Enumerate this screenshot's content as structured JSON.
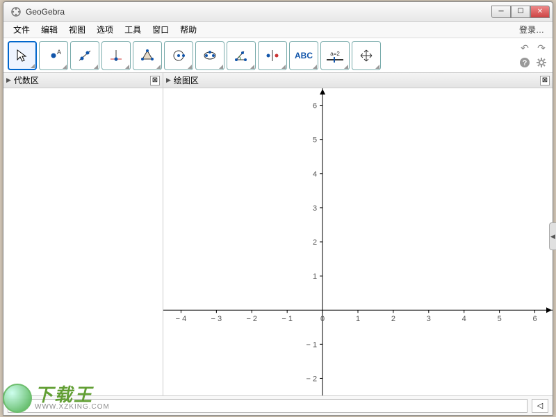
{
  "window": {
    "title": "GeoGebra"
  },
  "menu": {
    "items": [
      "文件",
      "编辑",
      "视图",
      "选项",
      "工具",
      "窗口",
      "帮助"
    ],
    "login": "登录…"
  },
  "toolbar": {
    "tools": [
      {
        "name": "move-tool",
        "selected": true
      },
      {
        "name": "point-tool",
        "selected": false
      },
      {
        "name": "line-tool",
        "selected": false
      },
      {
        "name": "perpendicular-tool",
        "selected": false
      },
      {
        "name": "polygon-tool",
        "selected": false
      },
      {
        "name": "circle-tool",
        "selected": false
      },
      {
        "name": "ellipse-tool",
        "selected": false
      },
      {
        "name": "angle-tool",
        "selected": false
      },
      {
        "name": "reflect-tool",
        "selected": false
      },
      {
        "name": "text-tool",
        "selected": false
      },
      {
        "name": "slider-tool",
        "selected": false
      },
      {
        "name": "move-graphics-tool",
        "selected": false
      }
    ],
    "text_label": "ABC",
    "slider_label": "a=2"
  },
  "panels": {
    "algebra": {
      "title": "代数区"
    },
    "graphics": {
      "title": "绘图区"
    }
  },
  "chart_data": {
    "type": "scatter",
    "title": "",
    "xlabel": "",
    "ylabel": "",
    "xlim": [
      -4.5,
      6.5
    ],
    "ylim": [
      -2.5,
      6.5
    ],
    "xticks": [
      -4,
      -3,
      -2,
      -1,
      0,
      1,
      2,
      3,
      4,
      5,
      6
    ],
    "yticks": [
      -2,
      -1,
      0,
      1,
      2,
      3,
      4,
      5,
      6
    ],
    "series": []
  },
  "input": {
    "placeholder": ""
  },
  "watermark": {
    "text": "下载王",
    "url": "WWW.XZKING.COM"
  }
}
